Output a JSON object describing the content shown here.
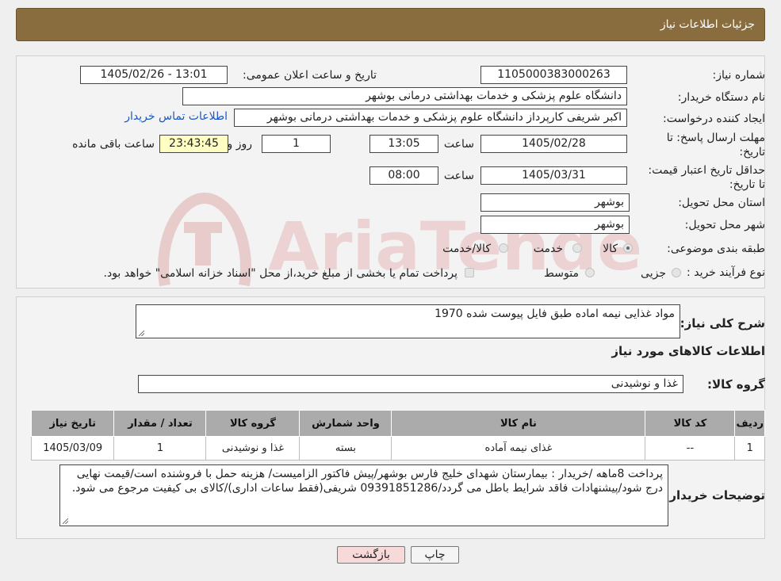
{
  "header": {
    "title": "جزئیات اطلاعات نیاز"
  },
  "form": {
    "need_number_label": "شماره نیاز:",
    "need_number": "1105000383000263",
    "announce_label": "تاریخ و ساعت اعلان عمومی:",
    "announce_value": "1405/02/26 - 13:01",
    "buyer_org_label": "نام دستگاه خریدار:",
    "buyer_org": "دانشگاه علوم پزشکی و خدمات بهداشتی درمانی بوشهر",
    "creator_label": "ایجاد کننده درخواست:",
    "creator": "اکبر شریفی کارپرداز دانشگاه علوم پزشکی و خدمات بهداشتی درمانی بوشهر",
    "contact_link": "اطلاعات تماس خریدار",
    "deadline_label": "مهلت ارسال پاسخ: تا تاریخ:",
    "deadline_date": "1405/02/28",
    "time_label": "ساعت",
    "deadline_time": "13:05",
    "days_value": "1",
    "days_label": "روز و",
    "remaining_time": "23:43:45",
    "remaining_label": "ساعت باقی مانده",
    "price_validity_label": "حداقل تاریخ اعتبار قیمت: تا تاریخ:",
    "price_validity_date": "1405/03/31",
    "price_validity_time": "08:00",
    "province_label": "استان محل تحویل:",
    "province": "بوشهر",
    "city_label": "شهر محل تحویل:",
    "city": "بوشهر",
    "category_label": "طبقه بندی موضوعی:",
    "category_options": [
      "کالا",
      "خدمت",
      "کالا/خدمت"
    ],
    "category_selected": "کالا",
    "purchase_type_label": "نوع فرآیند خرید :",
    "purchase_options": [
      "جزیی",
      "متوسط"
    ],
    "purchase_note": "پرداخت تمام یا بخشی از مبلغ خرید،از محل \"اسناد خزانه اسلامی\" خواهد بود."
  },
  "summary": {
    "description_label": "شرح کلی نیاز:",
    "description": "مواد غذایی نیمه اماده طبق فایل پیوست شده 1970",
    "goods_info_title": "اطلاعات کالاهای مورد نیاز",
    "goods_group_label": "گروه کالا:",
    "goods_group": "غذا و نوشیدنی",
    "table": {
      "headers": [
        "ردیف",
        "کد کالا",
        "نام کالا",
        "واحد شمارش",
        "گروه کالا",
        "تعداد / مقدار",
        "تاریخ نیاز"
      ],
      "rows": [
        [
          "1",
          "--",
          "غذای نیمه آماده",
          "بسته",
          "غذا و نوشیدنی",
          "1",
          "1405/03/09"
        ]
      ]
    },
    "buyer_notes_label": "توضیحات خریدار:",
    "buyer_notes": "پرداخت 8ماهه /خریدار : بیمارستان شهدای خلیج فارس بوشهر/پیش فاکتور الزامیست/ هزینه حمل با فروشنده است/قیمت نهایی درج شود/پیشنهادات فاقد شرایط باطل می گردد/09391851286 شریفی(فقط ساعات اداری)/کالای بی کیفیت مرجوع می شود."
  },
  "buttons": {
    "print": "چاپ",
    "back": "بازگشت"
  },
  "watermark": {
    "text": "AriaTender.neT",
    "color": "#e7c9c9"
  },
  "colors": {
    "header_bg": "#8a6d3f",
    "link": "#1a56c7",
    "remaining_bg": "#ffffc4",
    "back_btn_bg": "#f7d9d9"
  }
}
